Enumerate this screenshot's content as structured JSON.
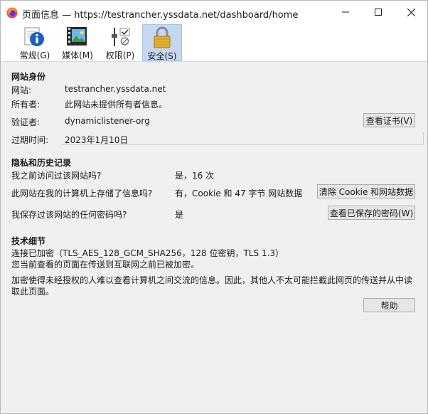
{
  "window": {
    "title": "页面信息 — https://testrancher.yssdata.net/dashboard/home"
  },
  "toolbar": {
    "tabs": [
      {
        "label": "常规(G)",
        "icon": "info-icon"
      },
      {
        "label": "媒体(M)",
        "icon": "media-icon"
      },
      {
        "label": "权限(P)",
        "icon": "permissions-icon"
      },
      {
        "label": "安全(S)",
        "icon": "lock-icon",
        "selected": true
      }
    ]
  },
  "identity": {
    "heading": "网站身份",
    "website_label": "网站:",
    "website_value": "testrancher.yssdata.net",
    "owner_label": "所有者:",
    "owner_value": "此网站未提供所有者信息。",
    "verifier_label": "验证者:",
    "verifier_value": "dynamiclistener-org",
    "view_cert_button": "查看证书(V)",
    "expires_label": "过期时间:",
    "expires_value": "2023年1月10日"
  },
  "privacy": {
    "heading": "隐私和历史记录",
    "visited_question": "我之前访问过该网站吗?",
    "visited_answer": "是，16 次",
    "stored_question": "此网站在我的计算机上存储了信息吗?",
    "stored_answer": "有，Cookie 和 47 字节 网站数据",
    "clear_button": "清除 Cookie 和网站数据",
    "password_question": "我保存过该网站的任何密码吗?",
    "password_answer": "是",
    "view_passwords_button": "查看已保存的密码(W)"
  },
  "technical": {
    "heading": "技术细节",
    "line1": "连接已加密（TLS_AES_128_GCM_SHA256，128 位密钥，TLS 1.3）",
    "line2": "您当前查看的页面在传送到互联网之前已被加密。",
    "line3": "加密使得未经授权的人难以查看计算机之间交流的信息。因此，其他人不太可能拦截此网页的传送并从中读取此页面。"
  },
  "help_button": "帮助",
  "colors": {
    "selected_tab": "#c6d8f0",
    "window_bg": "#f0f0f0",
    "button_bg": "#e6e6e6"
  }
}
